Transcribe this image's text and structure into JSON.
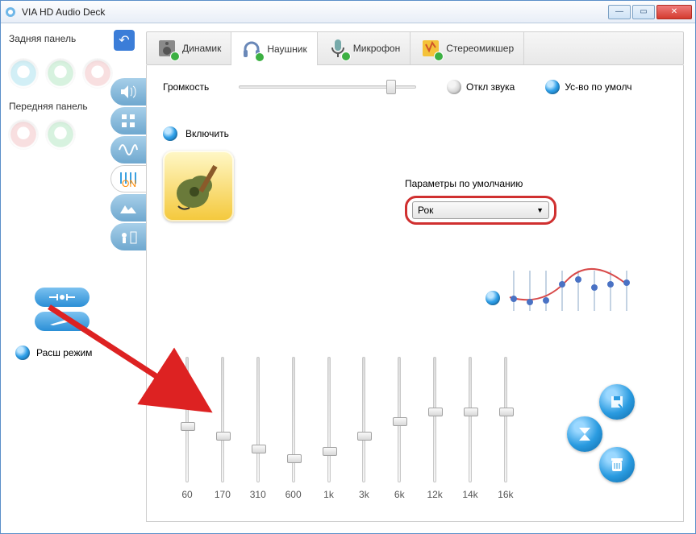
{
  "window": {
    "title": "VIA HD Audio Deck"
  },
  "sidebar": {
    "rear_label": "Задняя панель",
    "front_label": "Передняя панель",
    "rear_jacks": [
      "#aee3ef",
      "#b8e8c6",
      "#f4c6c8"
    ],
    "front_jacks": [
      "#f4c6c8",
      "#b8e8c6"
    ],
    "mode_label": "Расш режим"
  },
  "tabs": [
    {
      "key": "speaker",
      "label": "Динамик"
    },
    {
      "key": "headphone",
      "label": "Наушник"
    },
    {
      "key": "mic",
      "label": "Микрофон"
    },
    {
      "key": "mixer",
      "label": "Стереомикшер"
    }
  ],
  "active_tab": "headphone",
  "volume": {
    "label": "Громкость",
    "value_pct": 88,
    "mute_label": "Откл звука",
    "default_dev_label": "Ус-во по умолч"
  },
  "eq_panel": {
    "enable_label": "Включить",
    "preset_label": "Параметры по умолчанию",
    "preset_value": "Рок",
    "bands": [
      {
        "freq": "60",
        "pos": 52
      },
      {
        "freq": "170",
        "pos": 60
      },
      {
        "freq": "310",
        "pos": 70
      },
      {
        "freq": "600",
        "pos": 78
      },
      {
        "freq": "1k",
        "pos": 72
      },
      {
        "freq": "3k",
        "pos": 60
      },
      {
        "freq": "6k",
        "pos": 48
      },
      {
        "freq": "12k",
        "pos": 40
      },
      {
        "freq": "14k",
        "pos": 40
      },
      {
        "freq": "16k",
        "pos": 40
      }
    ]
  }
}
